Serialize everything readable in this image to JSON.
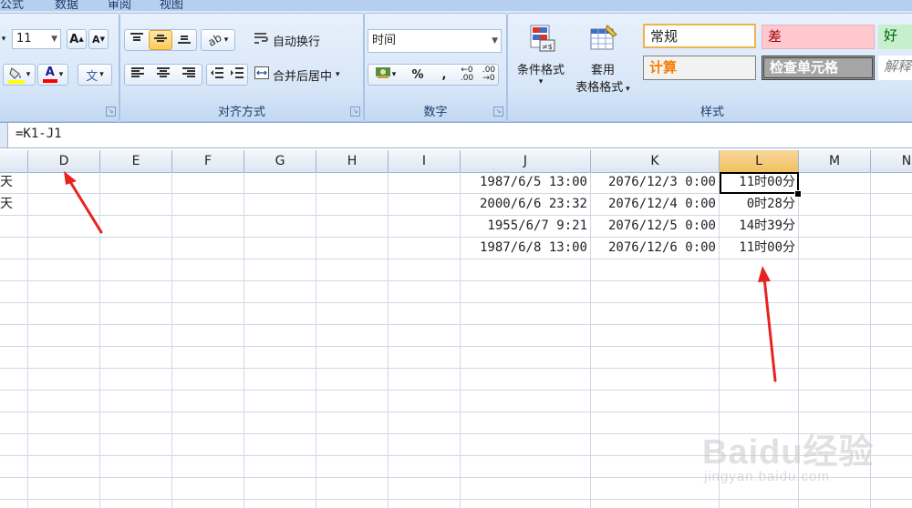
{
  "ribbon": {
    "tabs": [
      "公式",
      "数据",
      "审阅",
      "视图"
    ],
    "font": {
      "size_value": "11",
      "grow_label": "A",
      "shrink_label": "A",
      "fill_color": "#ffff00",
      "font_color": "#ff0000",
      "font_color_letter": "A",
      "phonetic_label": "文"
    },
    "alignment": {
      "label": "对齐方式",
      "wrap_text": "自动换行",
      "merge_center": "合并后居中"
    },
    "number": {
      "label": "数字",
      "format_value": "时间",
      "percent": "%",
      "comma": ",",
      "inc_decimal": ".00",
      "dec_decimal": ".00"
    },
    "styles": {
      "label": "样式",
      "conditional_format": "条件格式",
      "table_format_top": "套用",
      "table_format_bottom": "表格格式",
      "normal": "常规",
      "bad": "差",
      "good": "好",
      "calculation": "计算",
      "check_cell": "检查单元格",
      "explanatory": "解释"
    }
  },
  "formula_bar": {
    "formula": "=K1-J1"
  },
  "columns": [
    "D",
    "E",
    "F",
    "G",
    "H",
    "I",
    "J",
    "K",
    "L",
    "M",
    "N"
  ],
  "selected_column": "L",
  "rows": [
    {
      "c": "天",
      "J": "1987/6/5 13:00",
      "K": "2076/12/3 0:00",
      "L": "11时00分"
    },
    {
      "c": "天",
      "J": "2000/6/6 23:32",
      "K": "2076/12/4 0:00",
      "L": "0时28分"
    },
    {
      "c": "",
      "J": "1955/6/7 9:21",
      "K": "2076/12/5 0:00",
      "L": "14时39分"
    },
    {
      "c": "",
      "J": "1987/6/8 13:00",
      "K": "2076/12/6 0:00",
      "L": "11时00分"
    }
  ],
  "watermark": {
    "logo": "Baidu经验",
    "url": "jingyan.baidu.com"
  }
}
